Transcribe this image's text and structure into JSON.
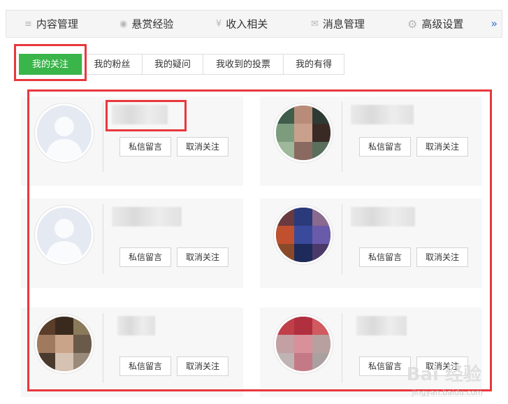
{
  "nav": {
    "items": [
      {
        "label": "内容管理",
        "icon": "≡"
      },
      {
        "label": "悬赏经验",
        "icon": "◉"
      },
      {
        "label": "收入相关",
        "icon": "¥"
      },
      {
        "label": "消息管理",
        "icon": "✉"
      },
      {
        "label": "高级设置",
        "icon": "⚙"
      }
    ],
    "more": "»"
  },
  "tabs": [
    {
      "label": "我的关注",
      "active": true
    },
    {
      "label": "我的粉丝",
      "active": false
    },
    {
      "label": "我的疑问",
      "active": false
    },
    {
      "label": "我收到的投票",
      "active": false
    },
    {
      "label": "我的有得",
      "active": false
    }
  ],
  "cards": {
    "message_label": "私信留言",
    "unfollow_label": "取消关注"
  },
  "watermark": {
    "text": "Bai 经验",
    "url": "jingyan.baidu.com"
  },
  "colors": {
    "accent": "#3ab54a",
    "annotation": "#e8383d",
    "link": "#3b72c8"
  }
}
